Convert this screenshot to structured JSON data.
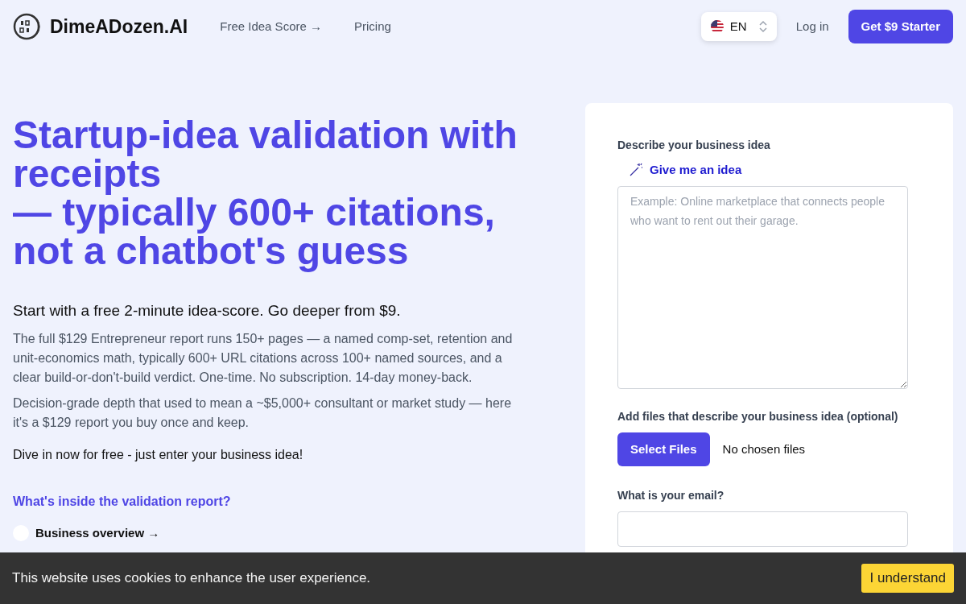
{
  "navbar": {
    "brand": "DimeADozen.AI",
    "links": [
      "Free Idea Score →",
      "Pricing"
    ],
    "language": "EN",
    "login": "Log in",
    "cta": "Get $9 Starter"
  },
  "hero": {
    "headline_1": "Startup-idea validation with receipts",
    "headline_2": "— **typically 600+** citations, not a chatbot's guess",
    "subtitle": "Start with a free 2-minute idea-score. Go deeper from $9.",
    "paragraphs": [
      "The full $129 Entrepreneur report runs 150+ pages — a named comp-set, retention and unit-economics math, typically 600+ URL citations across 100+ named sources, and a clear build-or-don't-build verdict. One-time. No subscription. 14-day money-back.",
      "Decision-grade depth that used to mean a ~$5,000+ consultant or market study — here it's a $129 report you buy once and keep."
    ],
    "call": "Dive in now for free - just enter your business idea!",
    "report_heading": "What's inside the validation report?",
    "report_items": [
      "Business overview →"
    ]
  },
  "form": {
    "idea_label": "Describe your business idea",
    "idea_button": "Give me an idea",
    "idea_placeholder": "Example: Online marketplace that connects people who want to rent out their garage.",
    "files_label": "Add files that describe your business idea (optional)",
    "files_button": "Select Files",
    "files_status": "No chosen files",
    "email_label": "What is your email?"
  },
  "cookie": {
    "text": "This website uses cookies to enhance the user experience.",
    "button": "I understand"
  }
}
